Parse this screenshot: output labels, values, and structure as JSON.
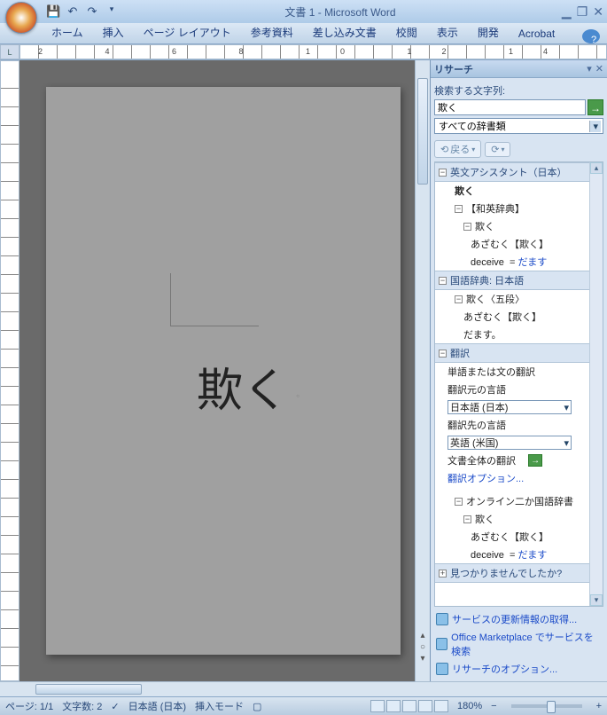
{
  "title": "文書 1 - Microsoft Word",
  "tabs": [
    "ホーム",
    "挿入",
    "ページ レイアウト",
    "参考資料",
    "差し込み文書",
    "校閲",
    "表示",
    "開発",
    "Acrobat"
  ],
  "ruler_corner": "L",
  "document_text": "欺く",
  "research": {
    "title": "リサーチ",
    "search_label": "検索する文字列:",
    "search_value": "欺く",
    "scope": "すべての辞書類",
    "back_label": "戻る",
    "cat_eiwa": "英文アシスタント（日本）",
    "r_headword": "欺く",
    "r_waei": "【和英辞典】",
    "r_entry1": "欺く",
    "r_reading1": "あざむく【欺く】",
    "r_deceive": "deceive",
    "r_damasu_link": "だます",
    "cat_kokugo": "国語辞典: 日本語",
    "r_entry2": "欺く〈五段〉",
    "r_reading2": "あざむく【欺く】",
    "r_damasu": "だます。",
    "cat_honyaku": "翻訳",
    "tr_sentence": "単語または文の翻訳",
    "tr_from_label": "翻訳元の言語",
    "tr_from_value": "日本語 (日本)",
    "tr_to_label": "翻訳先の言語",
    "tr_to_value": "英語 (米国)",
    "tr_whole_doc": "文書全体の翻訳",
    "tr_options": "翻訳オプション...",
    "cat_online": "オンライン二か国語辞書",
    "r_entry3": "欺く",
    "r_reading3": "あざむく【欺く】",
    "cat_notfound": "見つかりませんでしたか?",
    "footer_update": "サービスの更新情報の取得...",
    "footer_marketplace": "Office Marketplace でサービスを検索",
    "footer_options": "リサーチのオプション..."
  },
  "status": {
    "page": "ページ: 1/1",
    "words": "文字数: 2",
    "lang": "日本語 (日本)",
    "mode": "挿入モード",
    "zoom": "180%"
  }
}
